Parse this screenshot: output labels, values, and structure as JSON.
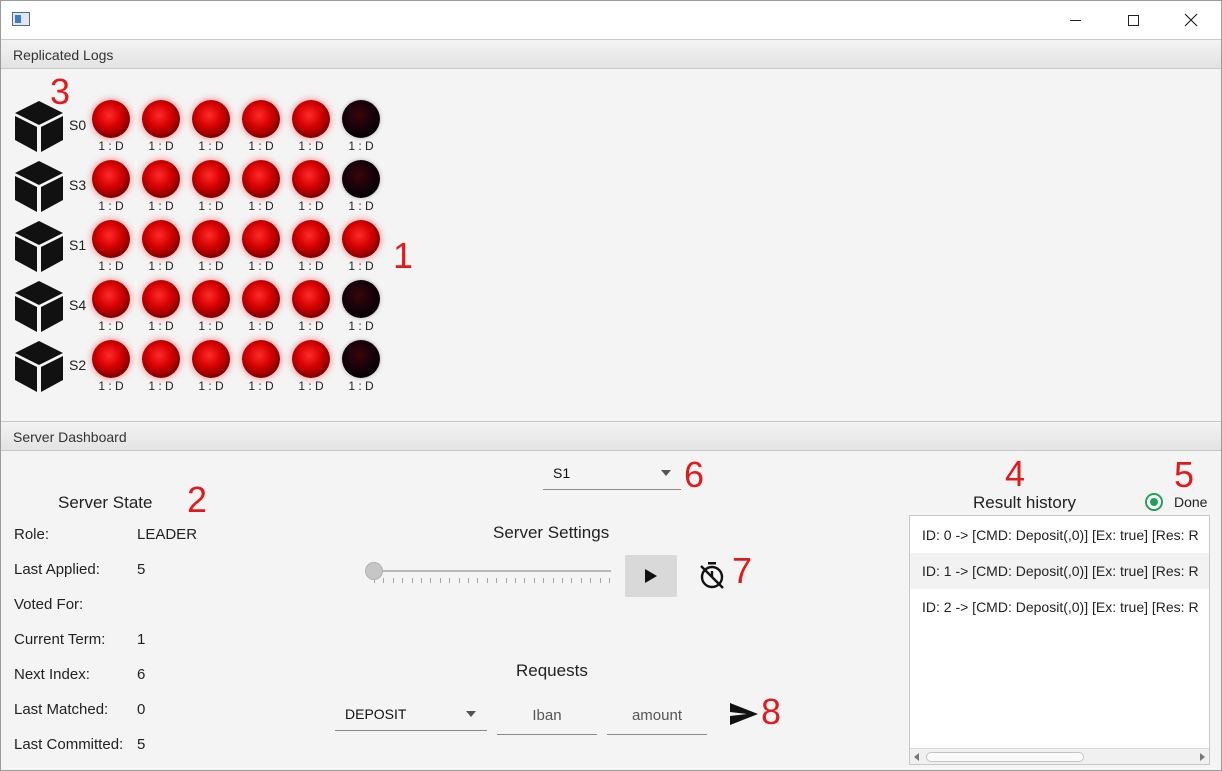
{
  "window": {
    "title": ""
  },
  "logs": {
    "header": "Replicated Logs",
    "rows": [
      {
        "server": "S0",
        "entries": [
          {
            "label": "1 : D",
            "state": "on"
          },
          {
            "label": "1 : D",
            "state": "on"
          },
          {
            "label": "1 : D",
            "state": "on"
          },
          {
            "label": "1 : D",
            "state": "on"
          },
          {
            "label": "1 : D",
            "state": "on"
          },
          {
            "label": "1 : D",
            "state": "off"
          }
        ]
      },
      {
        "server": "S3",
        "entries": [
          {
            "label": "1 : D",
            "state": "on"
          },
          {
            "label": "1 : D",
            "state": "on"
          },
          {
            "label": "1 : D",
            "state": "on"
          },
          {
            "label": "1 : D",
            "state": "on"
          },
          {
            "label": "1 : D",
            "state": "on"
          },
          {
            "label": "1 : D",
            "state": "off"
          }
        ]
      },
      {
        "server": "S1",
        "entries": [
          {
            "label": "1 : D",
            "state": "on"
          },
          {
            "label": "1 : D",
            "state": "on"
          },
          {
            "label": "1 : D",
            "state": "on"
          },
          {
            "label": "1 : D",
            "state": "on"
          },
          {
            "label": "1 : D",
            "state": "on"
          },
          {
            "label": "1 : D",
            "state": "on"
          }
        ]
      },
      {
        "server": "S4",
        "entries": [
          {
            "label": "1 : D",
            "state": "on"
          },
          {
            "label": "1 : D",
            "state": "on"
          },
          {
            "label": "1 : D",
            "state": "on"
          },
          {
            "label": "1 : D",
            "state": "on"
          },
          {
            "label": "1 : D",
            "state": "on"
          },
          {
            "label": "1 : D",
            "state": "off"
          }
        ]
      },
      {
        "server": "S2",
        "entries": [
          {
            "label": "1 : D",
            "state": "on"
          },
          {
            "label": "1 : D",
            "state": "on"
          },
          {
            "label": "1 : D",
            "state": "on"
          },
          {
            "label": "1 : D",
            "state": "on"
          },
          {
            "label": "1 : D",
            "state": "on"
          },
          {
            "label": "1 : D",
            "state": "off"
          }
        ]
      }
    ]
  },
  "annotations": [
    "1",
    "2",
    "3",
    "4",
    "5",
    "6",
    "7",
    "8"
  ],
  "dashboard": {
    "header": "Server Dashboard",
    "server_state": {
      "title": "Server State",
      "fields": [
        {
          "key": "Role:",
          "value": "LEADER"
        },
        {
          "key": "Last Applied:",
          "value": "5"
        },
        {
          "key": "Voted For:",
          "value": ""
        },
        {
          "key": "Current Term:",
          "value": "1"
        },
        {
          "key": "Next Index:",
          "value": "6"
        },
        {
          "key": "Last Matched:",
          "value": "0"
        },
        {
          "key": "Last Committed:",
          "value": "5"
        }
      ]
    },
    "server_select": {
      "value": "S1"
    },
    "settings": {
      "title": "Server Settings",
      "slider_value": 0
    },
    "requests": {
      "title": "Requests",
      "type_value": "DEPOSIT",
      "iban_placeholder": "Iban",
      "amount_placeholder": "amount"
    },
    "history": {
      "title": "Result history",
      "done_label": "Done",
      "items": [
        "ID: 0 -> [CMD: Deposit(,0)] [Ex: true] [Res: R",
        "ID: 1 -> [CMD: Deposit(,0)] [Ex: true] [Res: R",
        "ID: 2 -> [CMD: Deposit(,0)] [Ex: true] [Res: R"
      ]
    }
  },
  "colors": {
    "accent_red": "#e11b1b",
    "led_on": "#d40000",
    "led_off": "#16020a",
    "done_green": "#22a05a"
  },
  "icons": {
    "server": "cube-icon",
    "timer": "timer-off-icon",
    "play": "play-icon",
    "send": "send-icon"
  }
}
